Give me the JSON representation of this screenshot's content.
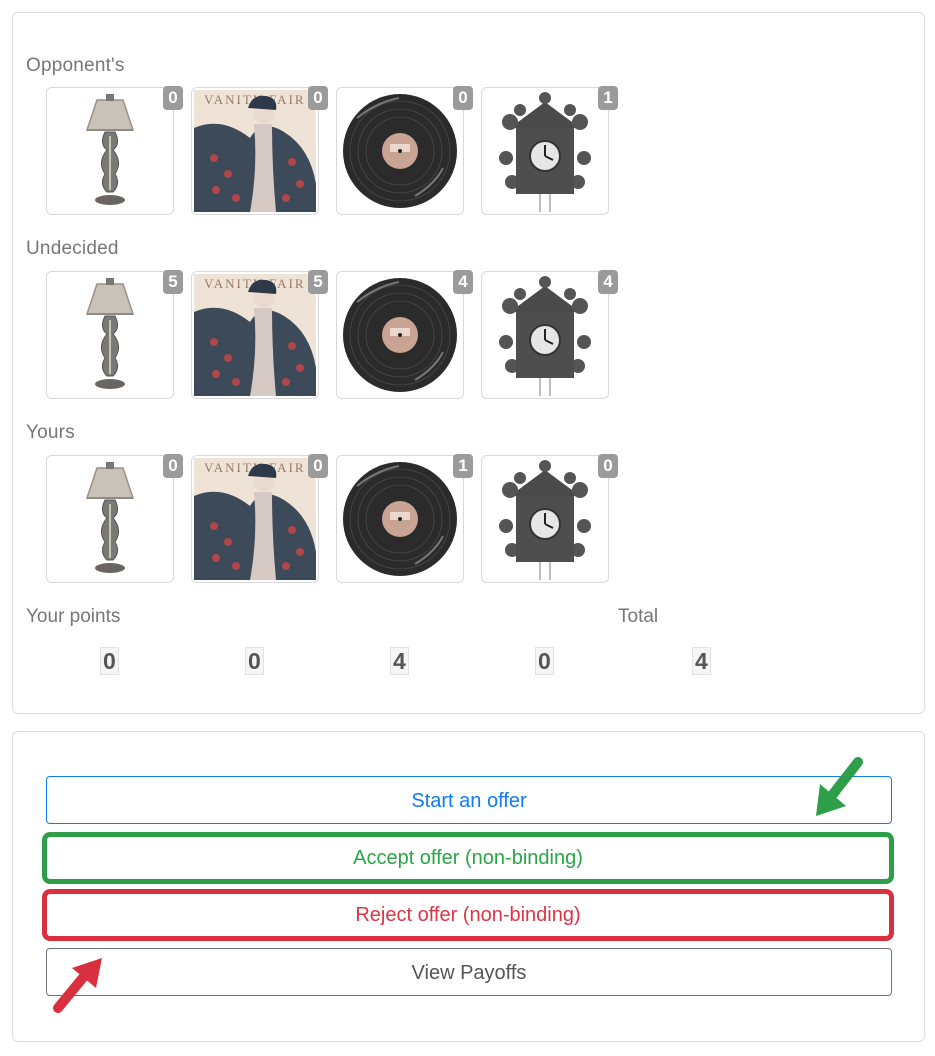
{
  "sections": {
    "opponent": {
      "label": "Opponent's",
      "counts": [
        "0",
        "0",
        "0",
        "1"
      ]
    },
    "undecided": {
      "label": "Undecided",
      "counts": [
        "5",
        "5",
        "4",
        "4"
      ]
    },
    "yours": {
      "label": "Yours",
      "counts": [
        "0",
        "0",
        "1",
        "0"
      ]
    }
  },
  "items": [
    "lamp-icon",
    "vanity-fair-painting-icon",
    "vinyl-record-icon",
    "cuckoo-clock-icon"
  ],
  "points": {
    "label": "Your points",
    "total_label": "Total",
    "values": [
      "0",
      "0",
      "4",
      "0"
    ],
    "total": "4"
  },
  "buttons": {
    "start": "Start an offer",
    "accept": "Accept offer (non-binding)",
    "reject": "Reject offer (non-binding)",
    "payoffs": "View Payoffs"
  },
  "colors": {
    "start": "#0d7bf6",
    "accept": "#28a745",
    "reject": "#dc3545",
    "badge": "#9b9b9b",
    "green_arrow": "#2e9e48",
    "red_arrow": "#d8303f"
  }
}
